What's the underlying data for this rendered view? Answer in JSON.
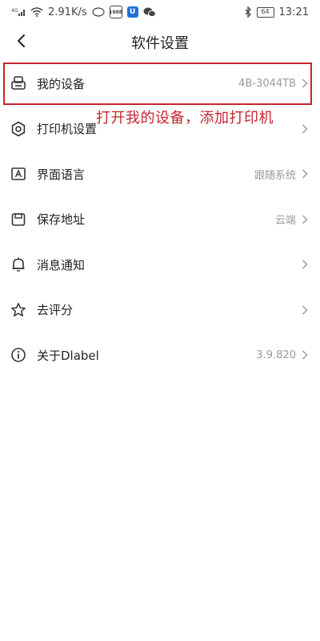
{
  "status_bar": {
    "signal_text": "4G",
    "speed": "2.91K/s",
    "badge_text": "1688",
    "battery": "64",
    "time": "13:21"
  },
  "header": {
    "title": "软件设置"
  },
  "settings": [
    {
      "label": "我的设备",
      "value": "4B-3044TB",
      "icon": "printer-device-icon"
    },
    {
      "label": "打印机设置",
      "value": "",
      "icon": "gear-icon"
    },
    {
      "label": "界面语言",
      "value": "跟随系统",
      "icon": "language-icon"
    },
    {
      "label": "保存地址",
      "value": "云端",
      "icon": "storage-icon"
    },
    {
      "label": "消息通知",
      "value": "",
      "icon": "bell-icon"
    },
    {
      "label": "去评分",
      "value": "",
      "icon": "star-icon"
    },
    {
      "label": "关于Dlabel",
      "value": "3.9.820",
      "icon": "info-icon"
    }
  ],
  "annotation": {
    "text": "打开我的设备，添加打印机"
  },
  "colors": {
    "highlight": "#c4262e",
    "value_text": "#9a9a9a"
  }
}
